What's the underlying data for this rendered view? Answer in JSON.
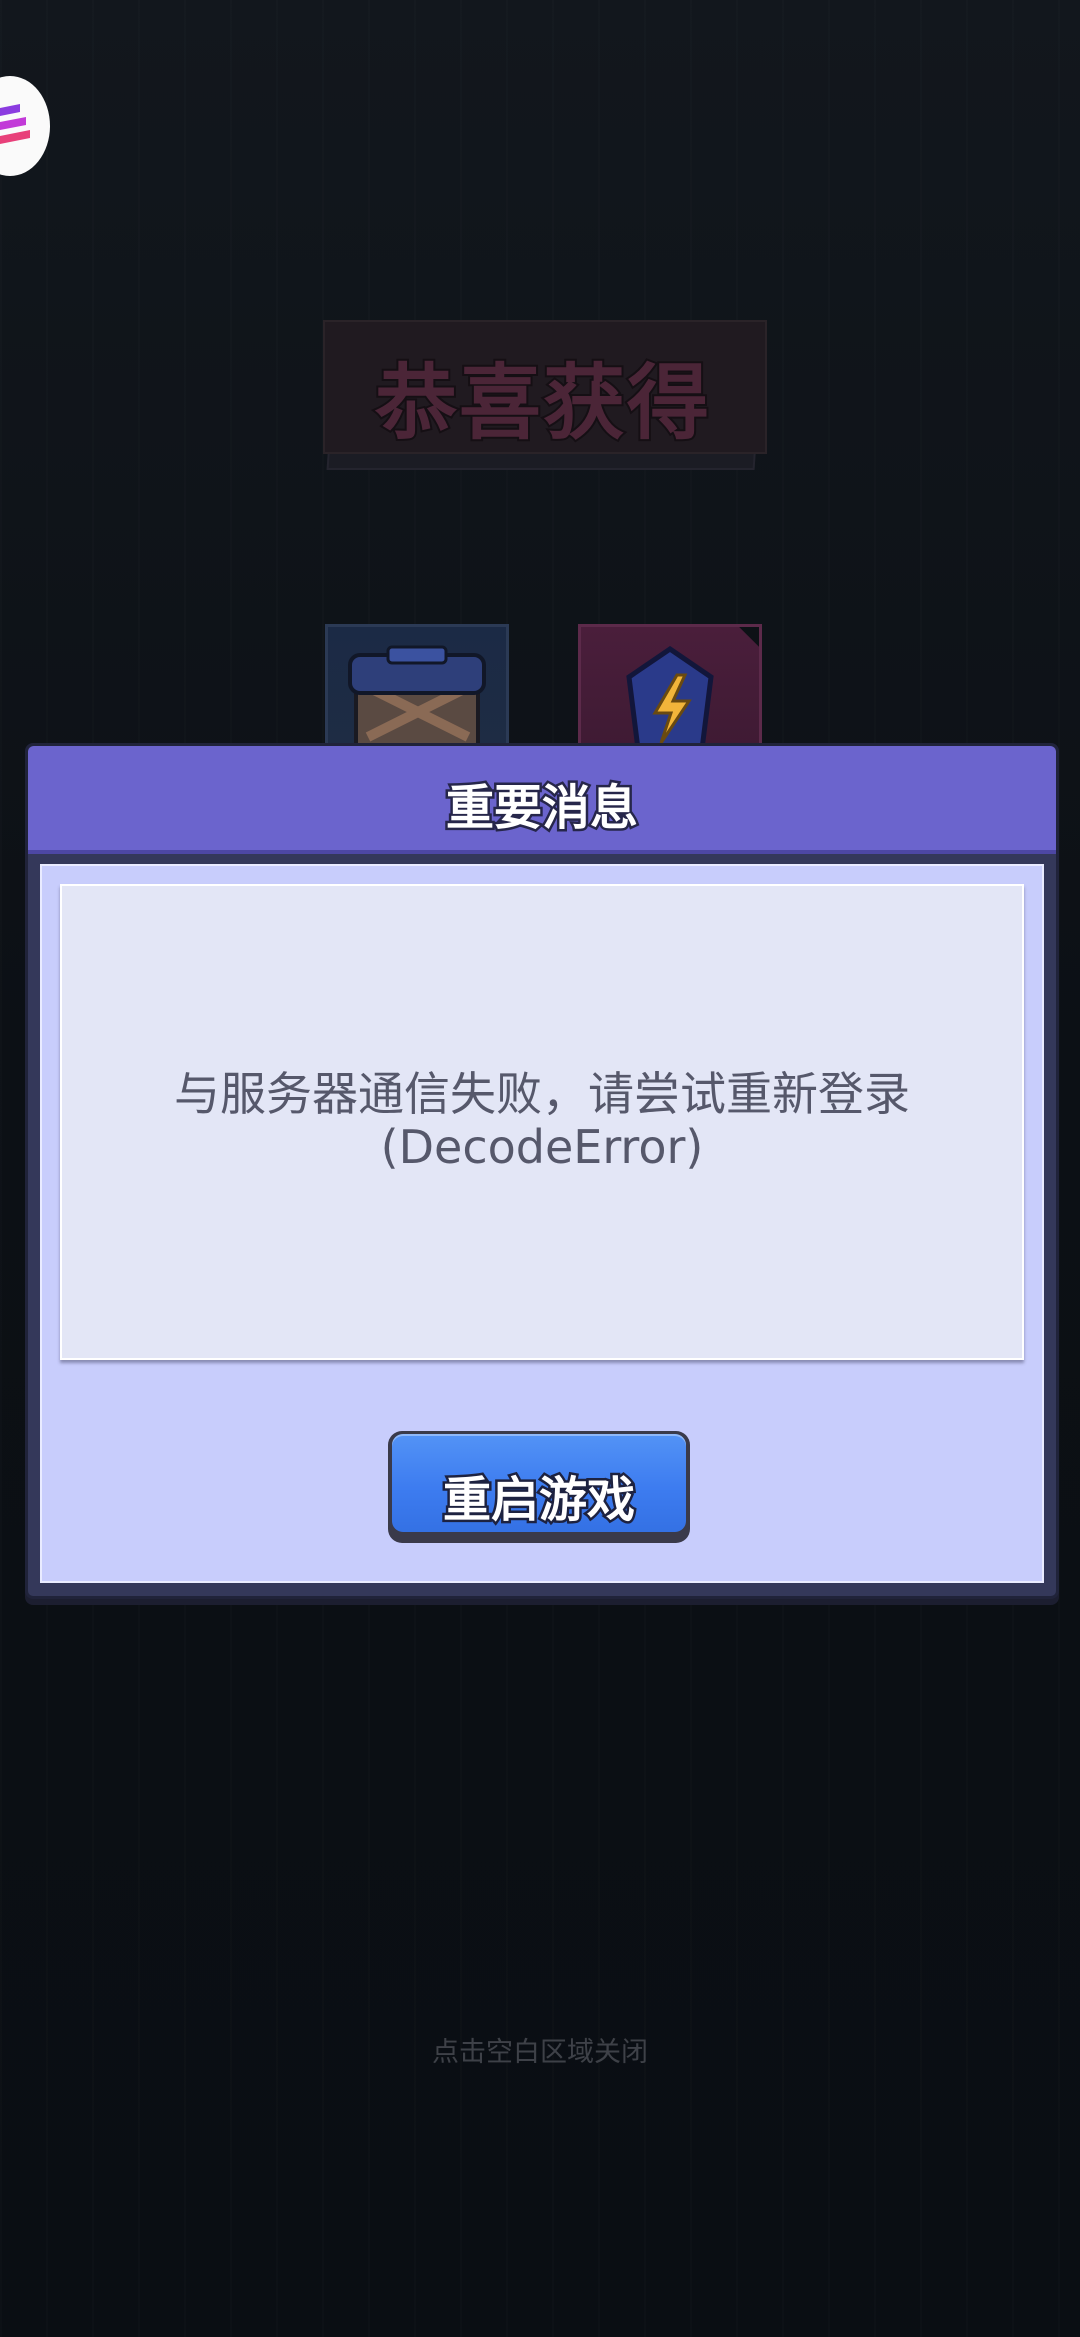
{
  "banner": {
    "title": "恭喜获得"
  },
  "dialog": {
    "title": "重要消息",
    "message_line1": "与服务器通信失败，请尝试重新登录",
    "message_line2": "(DecodeError)",
    "restart_button_label": "重启游戏"
  },
  "footer": {
    "close_hint": "点击空白区域关闭"
  },
  "rewards": [
    {
      "icon": "treasure-chest-icon"
    },
    {
      "icon": "energy-crystal-icon"
    }
  ],
  "colors": {
    "dialog_header": "#6b64cd",
    "dialog_body": "#c8cdfc",
    "message_panel": "#e3e6f6",
    "button": "#3d7cf0",
    "background": "#0d1116"
  }
}
